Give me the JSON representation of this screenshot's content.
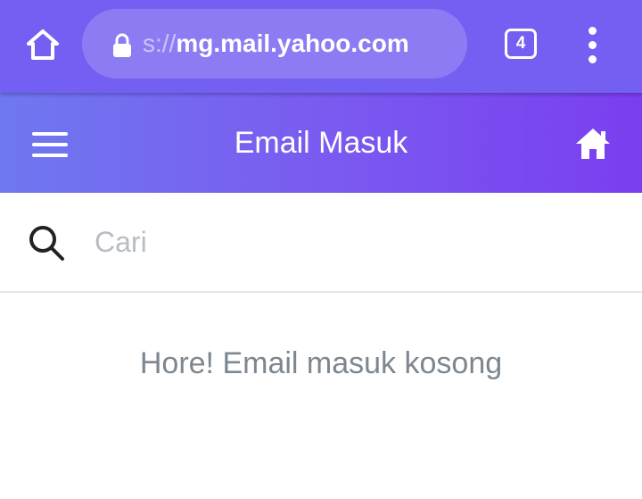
{
  "browser": {
    "url_prefix": "s://",
    "url_host": "mg.mail.yahoo.com",
    "tab_count": "4",
    "icons": {
      "home": "home-outline-icon",
      "lock": "lock-icon",
      "menu": "vertical-dots-icon"
    }
  },
  "header": {
    "title": "Email Masuk",
    "menu_icon": "hamburger-icon",
    "home_icon": "home-filled-icon"
  },
  "search": {
    "placeholder": "Cari",
    "value": "",
    "icon": "search-icon"
  },
  "inbox": {
    "empty_message": "Hore! Email masuk kosong"
  },
  "colors": {
    "browser_bar": "#7360f2",
    "header_gradient_start": "#6f78f0",
    "header_gradient_end": "#7a3ef0",
    "empty_text": "#7d8790",
    "placeholder": "#b8bdc4"
  }
}
